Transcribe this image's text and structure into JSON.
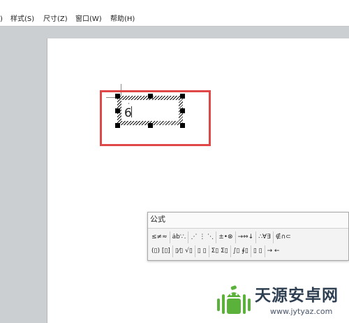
{
  "menubar": {
    "items": [
      {
        "label": ")"
      },
      {
        "label": "样式(S)"
      },
      {
        "label": "尺寸(Z)"
      },
      {
        "label": "窗口(W)"
      },
      {
        "label": "帮助(H)"
      }
    ]
  },
  "equation": {
    "text": "6",
    "dot": "·"
  },
  "palette": {
    "title": "公式",
    "row1": [
      "≤≠≈",
      "ȧb∵.",
      "⋰ ⋮ ⋱",
      "±•⊗",
      "→⇔↓",
      "∴∀∃",
      "∉∩⊂"
    ],
    "row2": [
      "(▯) [▯]",
      "▯⁄▯ √▯",
      "▯ ▯",
      "Σ▯ Σ▯",
      "∫▯ ∮▯",
      "▯ ▯",
      "→ ←"
    ]
  },
  "watermark": {
    "name": "天源安卓网",
    "url": "www.jytyaz.com",
    "colors": {
      "green": "#5bb23a",
      "dark": "#2f3f52"
    }
  },
  "colors": {
    "highlight": "#e04848",
    "workspace": "#cccfd2",
    "page": "#ffffff"
  }
}
